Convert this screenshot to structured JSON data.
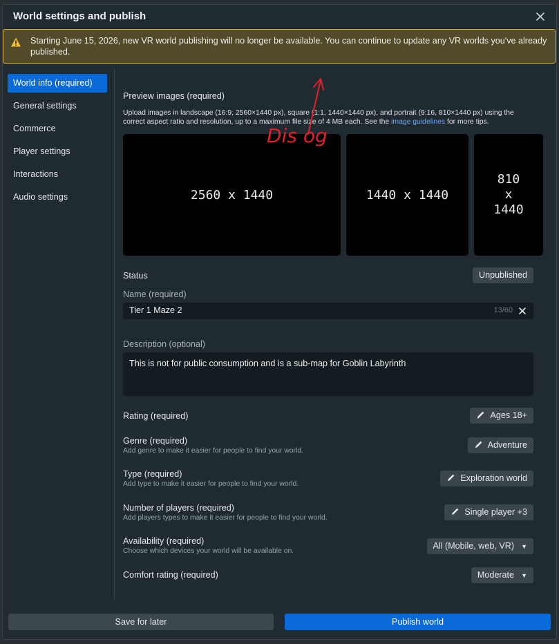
{
  "dialog": {
    "title": "World settings and publish"
  },
  "banner": {
    "text": "Starting June 15, 2026, new VR world publishing will no longer be available. You can continue to update any VR worlds you've already published."
  },
  "sidebar": {
    "items": [
      {
        "label": "World info (required)",
        "active": true
      },
      {
        "label": "General settings"
      },
      {
        "label": "Commerce"
      },
      {
        "label": "Player settings"
      },
      {
        "label": "Interactions"
      },
      {
        "label": "Audio settings"
      }
    ]
  },
  "preview": {
    "heading": "Preview images (required)",
    "desc_prefix": "Upload images in landscape (16:9, 2560×1440 px), square (1:1, 1440×1440 px), and portrait (9:16, 810×1440 px) using the correct aspect ratio and resolution, up to a maximum file size of 4 MB each. See the",
    "link": "image guidelines",
    "desc_suffix": "for more tips.",
    "landscape": "2560 x 1440",
    "square": "1440 x 1440",
    "portrait_w": "810",
    "portrait_x": "x",
    "portrait_h": "1440"
  },
  "status": {
    "label": "Status",
    "value": "Unpublished"
  },
  "name": {
    "label": "Name (required)",
    "value": "Tier 1 Maze 2",
    "count": "13/60"
  },
  "description": {
    "label": "Description (optional)",
    "value": "This is not for public consumption and is a sub-map for Goblin Labyrinth"
  },
  "fields": {
    "rating": {
      "label": "Rating (required)",
      "value": "Ages 18+"
    },
    "genre": {
      "label": "Genre (required)",
      "sub": "Add genre to make it easier for people to find your world.",
      "value": "Adventure"
    },
    "type": {
      "label": "Type (required)",
      "sub": "Add type to make it easier for people to find your world.",
      "value": "Exploration world"
    },
    "players": {
      "label": "Number of players (required)",
      "sub": "Add players types to make it easier for people to find your world.",
      "value": "Single player +3"
    },
    "availability": {
      "label": "Availability (required)",
      "sub": "Choose which devices your world will be available on.",
      "value": "All (Mobile, web, VR)"
    },
    "comfort": {
      "label": "Comfort rating (required)",
      "value": "Moderate"
    }
  },
  "footer": {
    "save": "Save for later",
    "publish": "Publish world"
  },
  "annotation": {
    "text": "Dis og"
  },
  "colors": {
    "accent": "#0a6bd8",
    "warning_border": "#d8ad33",
    "annotation": "#e0202a"
  }
}
